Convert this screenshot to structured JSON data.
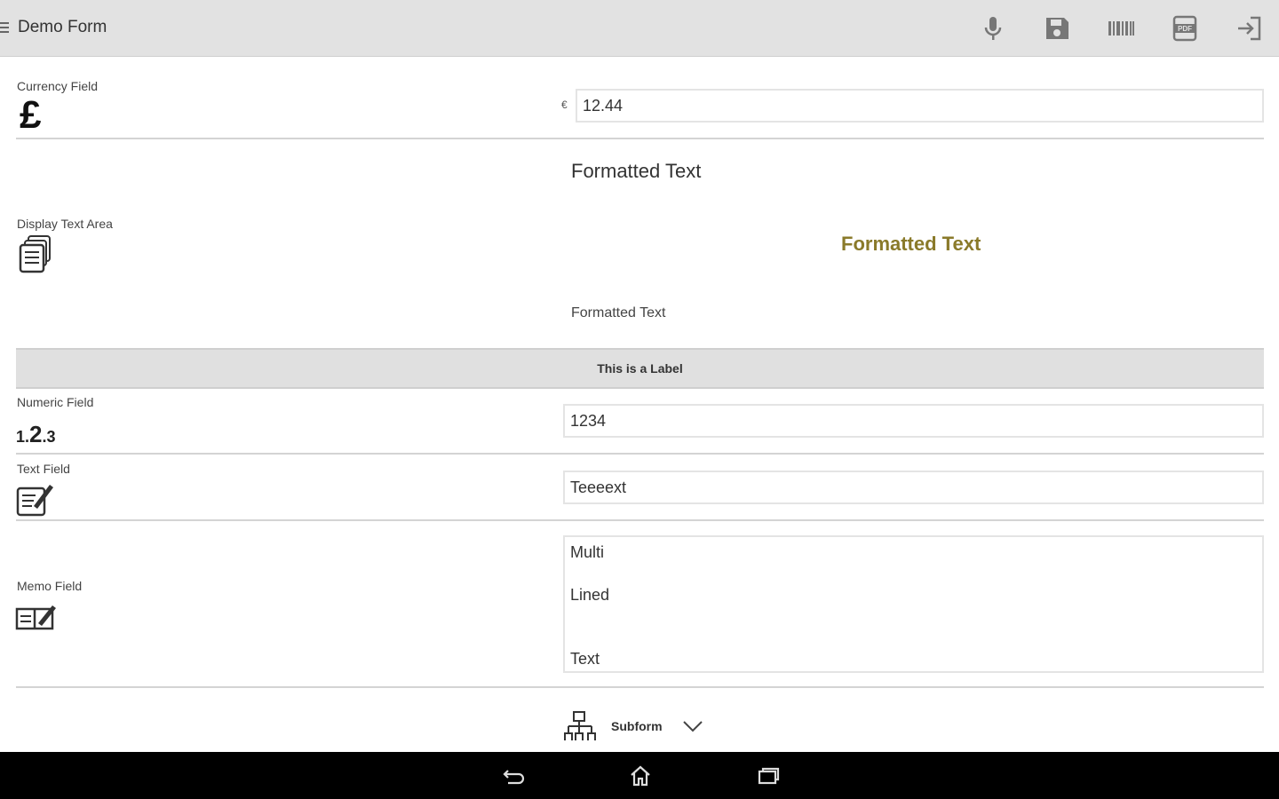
{
  "appbar": {
    "title": "Demo Form",
    "actions": [
      "microphone-icon",
      "save-icon",
      "barcode-icon",
      "pdf-icon",
      "exit-icon"
    ]
  },
  "fields": {
    "currency": {
      "label": "Currency Field",
      "symbol": "€",
      "value": "12.44",
      "icon": "£"
    },
    "display_text": {
      "label": "Display Text Area",
      "formatted_1": "Formatted Text",
      "formatted_2": "Formatted Text",
      "formatted_3": "Formatted Text",
      "formatted_2_color": "#8a7a2a"
    },
    "label_bar": "This is a Label",
    "numeric": {
      "label": "Numeric Field",
      "value": "1234",
      "icon_small_1": "1.",
      "icon_big": "2",
      "icon_small_2": ".3"
    },
    "text": {
      "label": "Text Field",
      "value": "Teeeext"
    },
    "memo": {
      "label": "Memo Field",
      "line1": "Multi",
      "line2": "Lined",
      "line3": "Text"
    },
    "subform": {
      "label": "Subform"
    }
  },
  "navbar": {
    "buttons": [
      "back-icon",
      "home-icon",
      "recent-apps-icon"
    ]
  }
}
